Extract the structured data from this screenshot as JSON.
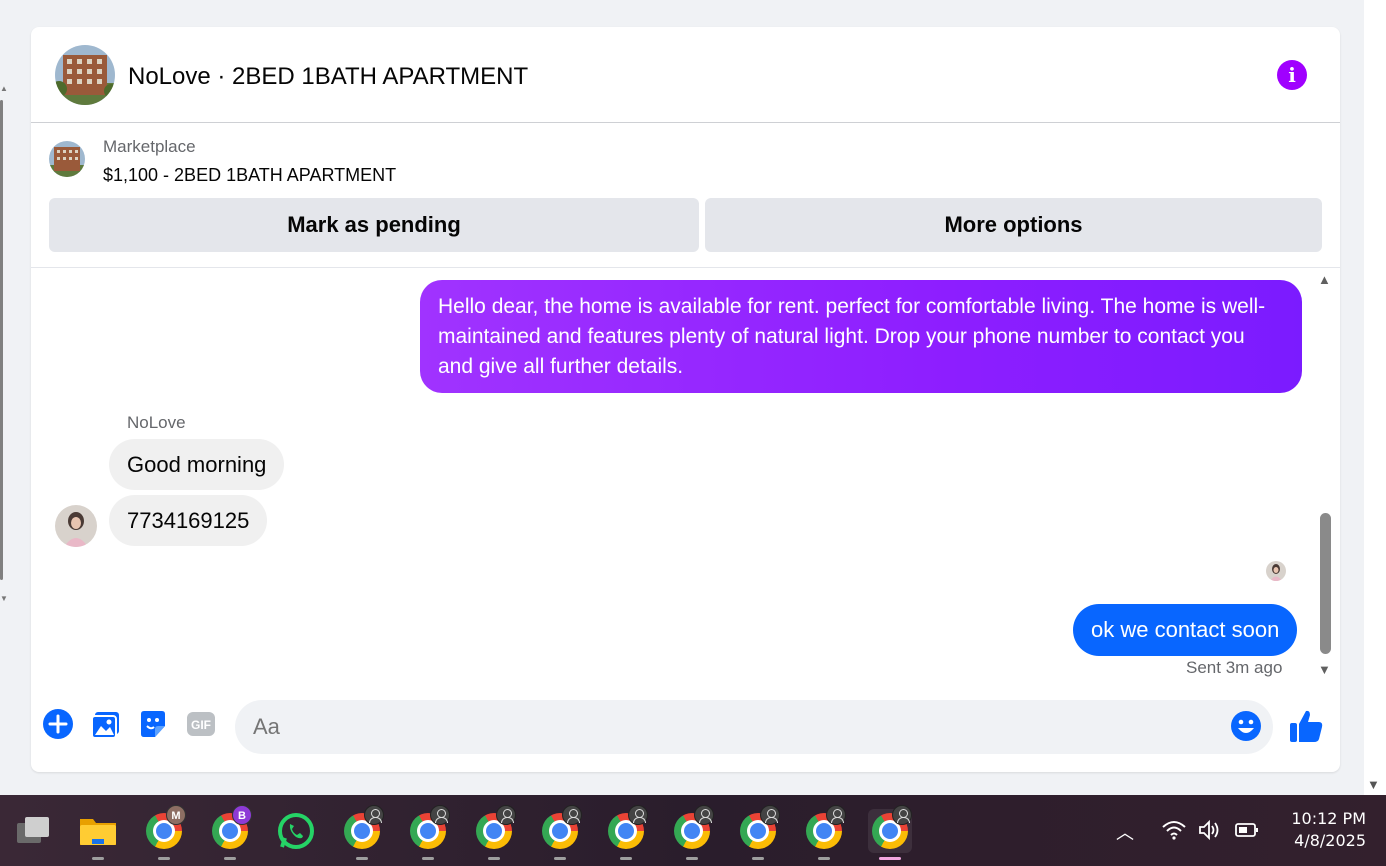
{
  "chat": {
    "title": "NoLove · 2BED 1BATH APARTMENT",
    "info_icon": "info-icon"
  },
  "listing": {
    "source": "Marketplace",
    "title": "$1,100 - 2BED 1BATH APARTMENT",
    "mark_pending_label": "Mark as pending",
    "more_options_label": "More options"
  },
  "messages": {
    "outgoing_1": "Hello dear,  the home is available for rent. perfect for comfortable living. The home is well-maintained and features plenty of natural light. Drop your phone number to contact you and give all further details.",
    "sender_name": "NoLove",
    "incoming_1": "Good morning",
    "incoming_2": "7734169125",
    "outgoing_2": "ok we contact soon",
    "status": "Sent 3m ago"
  },
  "composer": {
    "placeholder": "Aa",
    "icons": [
      "plus-icon",
      "photo-icon",
      "sticker-icon",
      "gif-icon",
      "emoji-icon",
      "thumbs-up-icon"
    ],
    "gif_label": "GIF"
  },
  "taskbar": {
    "apps": [
      "task-view",
      "file-explorer",
      "chrome-M",
      "chrome-B",
      "whatsapp",
      "chrome-guest",
      "chrome-guest",
      "chrome-guest",
      "chrome-guest",
      "chrome-guest",
      "chrome-guest",
      "chrome-guest",
      "chrome-guest",
      "chrome-guest-active"
    ],
    "profile_m": "M",
    "profile_b": "B",
    "time": "10:12 PM",
    "date": "4/8/2025"
  },
  "colors": {
    "accent": "#0866ff",
    "purple_bubble": "#8d1eff",
    "info": "#a000ff"
  }
}
